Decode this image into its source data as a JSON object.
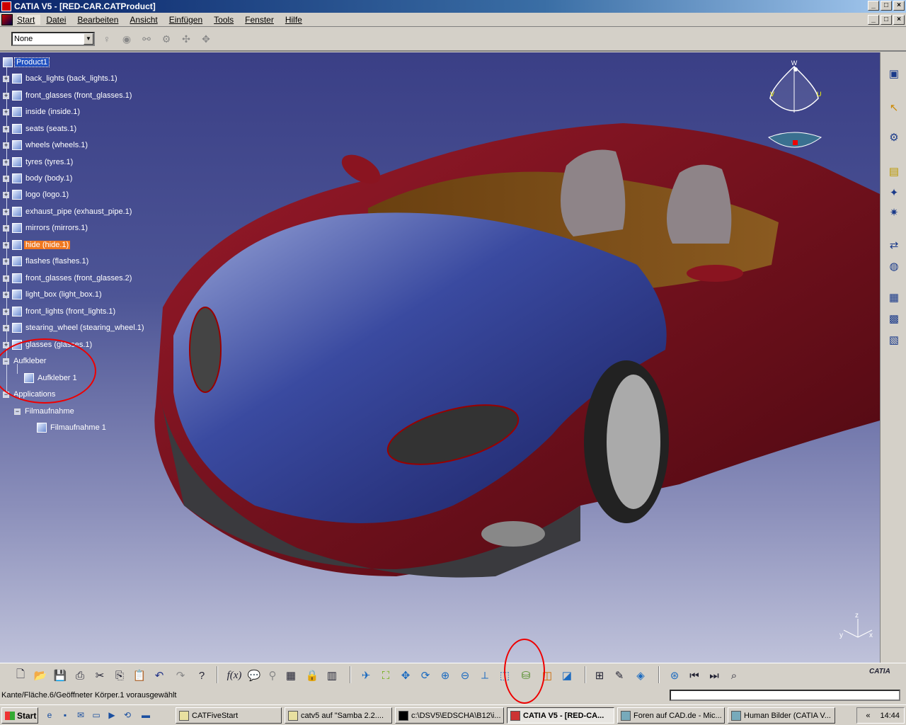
{
  "window": {
    "title": "CATIA V5 - [RED-CAR.CATProduct]",
    "buttons": [
      "_",
      "□",
      "×"
    ]
  },
  "menu": [
    "Start",
    "Datei",
    "Bearbeiten",
    "Ansicht",
    "Einfügen",
    "Tools",
    "Fenster",
    "Hilfe"
  ],
  "toolbar_top": {
    "select_value": "None"
  },
  "tree": {
    "root": "Product1",
    "items": [
      "back_lights (back_lights.1)",
      "front_glasses (front_glasses.1)",
      "inside (inside.1)",
      "seats (seats.1)",
      "wheels (wheels.1)",
      "tyres (tyres.1)",
      "body (body.1)",
      "logo (logo.1)",
      "exhaust_pipe (exhaust_pipe.1)",
      "mirrors (mirrors.1)",
      "hide (hide.1)",
      "flashes (flashes.1)",
      "front_glasses (front_glasses.2)",
      "light_box (light_box.1)",
      "front_lights (front_lights.1)",
      "stearing_wheel (stearing_wheel.1)",
      "glasses (glasses.1)"
    ],
    "aufkleber": "Aufkleber",
    "aufkleber_child": "Aufkleber 1",
    "applications": "Applications",
    "filmaufnahme": "Filmaufnahme",
    "filmaufnahme_child": "Filmaufnahme 1"
  },
  "compass": {
    "w": "W",
    "u": "U",
    "v": "V"
  },
  "axis": {
    "z": "z",
    "x": "x",
    "y": "y"
  },
  "status": {
    "text": "Kante/Fläche.6/Geöffneter Körper.1 vorausgewählt"
  },
  "taskbar": {
    "start": "Start",
    "tasks": [
      "CATFiveStart",
      "catv5 auf \"Samba 2.2....",
      "c:\\DSV5\\EDSCHA\\B12\\i...",
      "CATIA V5 - [RED-CA...",
      "Foren auf CAD.de - Mic...",
      "Human Bilder (CATIA V..."
    ],
    "tray_arrows": "«",
    "clock": "14:44"
  },
  "brand": "CATIA",
  "colors": {
    "title_bar": "#0a246a",
    "viewport_top": "#3a3f86",
    "car_body": "#6e0e1e",
    "selection": "#2050c0",
    "highlight": "#f07820",
    "annotation": "#e00000"
  }
}
